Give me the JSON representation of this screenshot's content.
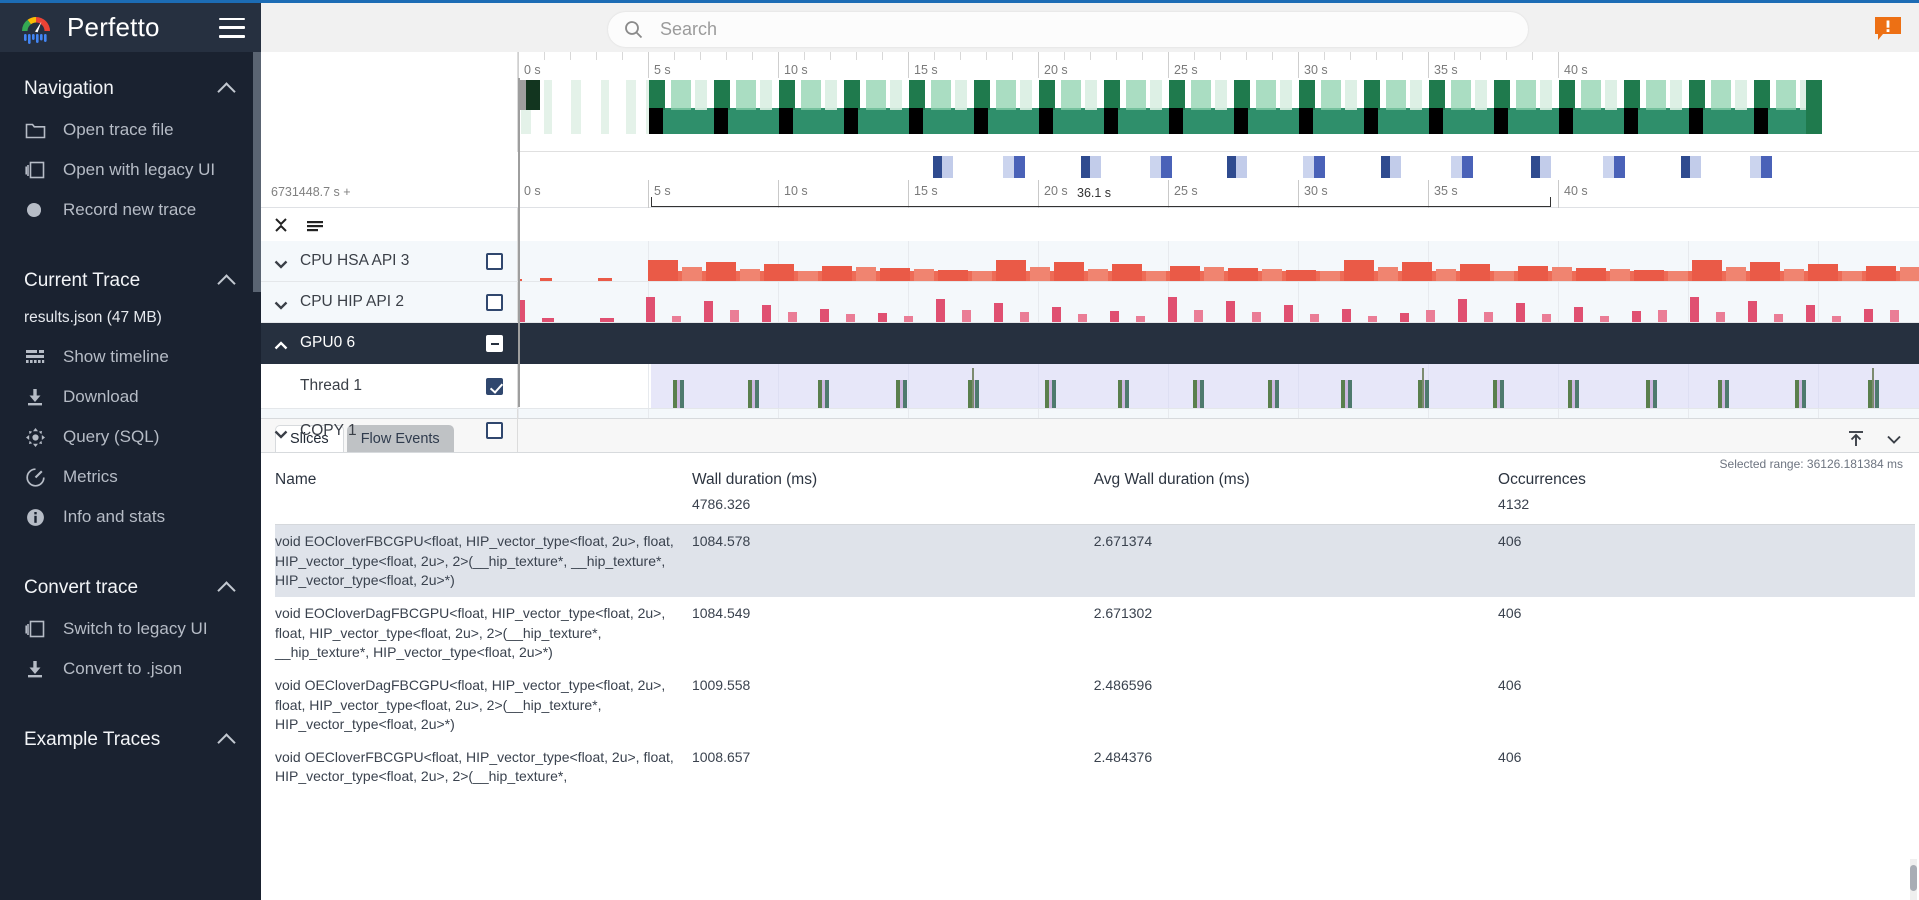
{
  "app": {
    "brand": "Perfetto",
    "logo_icon": "perfetto-logo-icon",
    "menu_icon": "hamburger-menu-icon",
    "accent_color": "#1c6cb5",
    "sidebar_bg": "#1a2230"
  },
  "search": {
    "placeholder": "Search",
    "value": "",
    "icon": "search-icon"
  },
  "notifications": {
    "icon": "warning-bubble-icon",
    "color": "#ed7014",
    "glyph": "!"
  },
  "sidebar": {
    "sections": [
      {
        "title": "Navigation",
        "collapse_icon": "chevron-up-icon",
        "items": [
          {
            "label": "Open trace file",
            "icon": "folder-icon"
          },
          {
            "label": "Open with legacy UI",
            "icon": "copy-icon"
          },
          {
            "label": "Record new trace",
            "icon": "record-circle-icon"
          }
        ]
      },
      {
        "title": "Current Trace",
        "collapse_icon": "chevron-up-icon",
        "filename": "results.json (47 MB)",
        "items": [
          {
            "label": "Show timeline",
            "icon": "timeline-icon"
          },
          {
            "label": "Download",
            "icon": "download-icon"
          },
          {
            "label": "Query (SQL)",
            "icon": "query-sql-icon"
          },
          {
            "label": "Metrics",
            "icon": "metrics-gauge-icon"
          },
          {
            "label": "Info and stats",
            "icon": "info-icon"
          }
        ]
      },
      {
        "title": "Convert trace",
        "collapse_icon": "chevron-up-icon",
        "items": [
          {
            "label": "Switch to legacy UI",
            "icon": "copy-icon"
          },
          {
            "label": "Convert to .json",
            "icon": "download-icon"
          }
        ]
      },
      {
        "title": "Example Traces",
        "collapse_icon": "chevron-up-icon",
        "items": []
      }
    ]
  },
  "timeline": {
    "time_offset_label": "6731448.7 s +",
    "overview_ticks": [
      "0 s",
      "5 s",
      "10 s",
      "15 s",
      "20 s",
      "25 s",
      "30 s",
      "35 s",
      "40 s"
    ],
    "ruler_ticks": [
      "0 s",
      "5 s",
      "10 s",
      "15 s",
      "20 s",
      "25 s",
      "30 s",
      "35 s",
      "40 s"
    ],
    "span_label": "36.1 s",
    "tools": [
      {
        "icon": "collapse-all-icon"
      },
      {
        "icon": "filter-lines-icon"
      }
    ],
    "tracks": [
      {
        "label": "CPU HSA API 3",
        "chevron": "chevron-down-icon",
        "checkbox": "unchecked",
        "style": "light",
        "series_color": "#ea5a47"
      },
      {
        "label": "CPU HIP API 2",
        "chevron": "chevron-down-icon",
        "checkbox": "unchecked",
        "style": "light",
        "series_color": "#e05071"
      },
      {
        "label": "GPU0 6",
        "chevron": "chevron-up-icon",
        "checkbox": "minus",
        "style": "group",
        "series_color": ""
      },
      {
        "label": "Thread 1",
        "chevron": "none",
        "checkbox": "checked",
        "style": "white",
        "series_color": "#5a7f4d"
      },
      {
        "label": "COPY 1",
        "chevron": "chevron-down-icon",
        "checkbox": "unchecked",
        "style": "light",
        "series_color": ""
      }
    ]
  },
  "details": {
    "tabs": [
      {
        "label": "Slices",
        "active": true
      },
      {
        "label": "Flow Events",
        "active": false
      }
    ],
    "actions": [
      {
        "icon": "pin-to-top-icon"
      },
      {
        "icon": "chevron-down-icon"
      }
    ],
    "selected_range": "Selected range: 36126.181384 ms",
    "columns": [
      "Name",
      "Wall duration (ms)",
      "Avg Wall duration (ms)",
      "Occurrences"
    ],
    "aggregates": {
      "name": "",
      "wall": "4786.326",
      "avg": "",
      "occurrences": "4132"
    },
    "rows": [
      {
        "name": "void EOCloverFBCGPU<float, HIP_vector_type<float, 2u>, float, HIP_vector_type<float, 2u>, 2>(__hip_texture*, __hip_texture*, HIP_vector_type<float, 2u>*)",
        "wall": "1084.578",
        "avg": "2.671374",
        "occurrences": "406"
      },
      {
        "name": "void EOCloverDagFBCGPU<float, HIP_vector_type<float, 2u>, float, HIP_vector_type<float, 2u>, 2>(__hip_texture*, __hip_texture*, HIP_vector_type<float, 2u>*)",
        "wall": "1084.549",
        "avg": "2.671302",
        "occurrences": "406"
      },
      {
        "name": "void OECloverDagFBCGPU<float, HIP_vector_type<float, 2u>, float, HIP_vector_type<float, 2u>, 2>(__hip_texture*, HIP_vector_type<float, 2u>*)",
        "wall": "1009.558",
        "avg": "2.486596",
        "occurrences": "406"
      },
      {
        "name": "void OECloverFBCGPU<float, HIP_vector_type<float, 2u>, float, HIP_vector_type<float, 2u>, 2>(__hip_texture*,",
        "wall": "1008.657",
        "avg": "2.484376",
        "occurrences": "406"
      }
    ]
  }
}
